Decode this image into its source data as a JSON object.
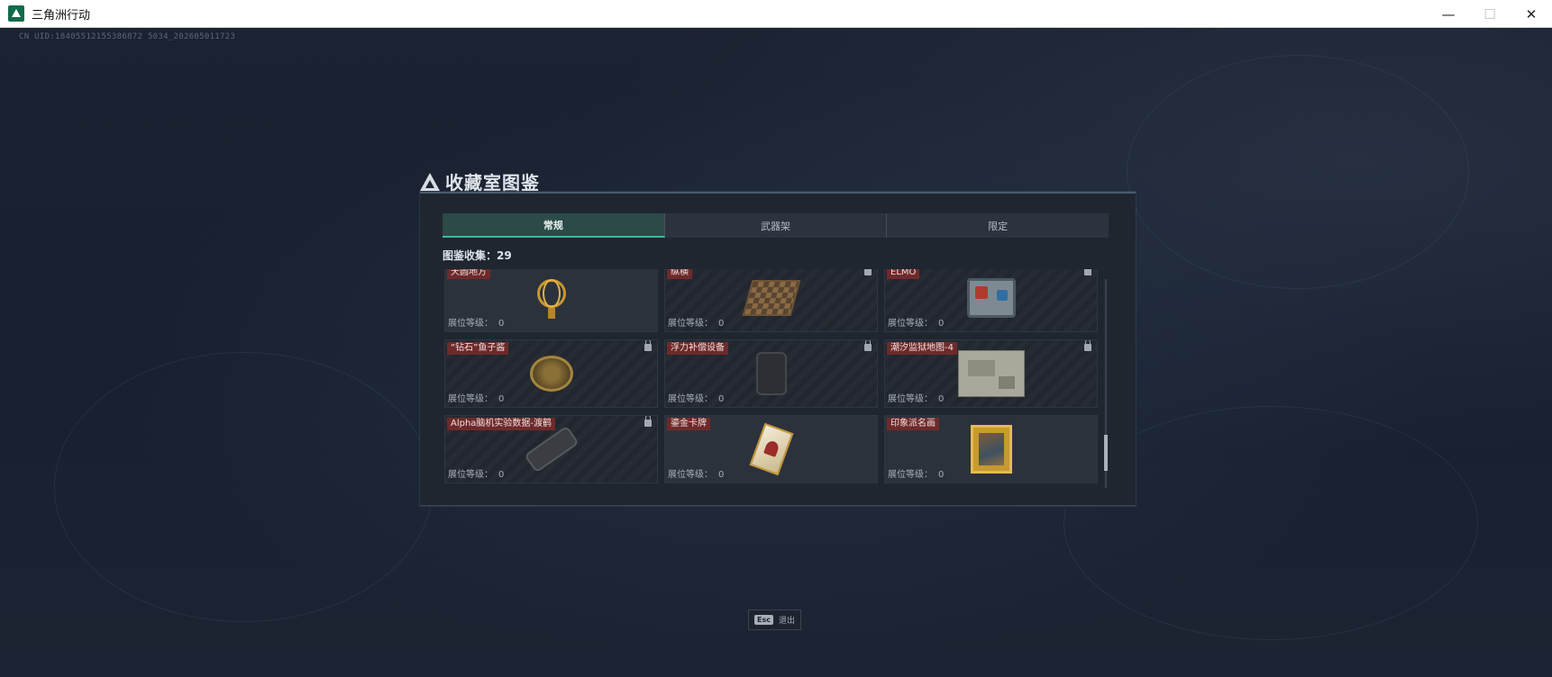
{
  "window": {
    "title": "三角洲行动",
    "controls": {
      "minimize": "—",
      "maximize": "☐",
      "close": "✕"
    }
  },
  "game": {
    "uid_text": "CN UID:18405512155386872 5034_202605011723"
  },
  "collection": {
    "title": "收藏室图鉴",
    "tabs": [
      {
        "label": "常规",
        "active": true
      },
      {
        "label": "武器架",
        "active": false
      },
      {
        "label": "限定",
        "active": false
      }
    ],
    "count_label": "图鉴收集：",
    "count_value": "29",
    "level_label": "展位等级：",
    "items": [
      {
        "name": "天圆地方",
        "level": "0",
        "locked": false,
        "art": "armillary"
      },
      {
        "name": "纵横",
        "level": "0",
        "locked": true,
        "art": "chess"
      },
      {
        "name": "ELMO",
        "level": "0",
        "locked": true,
        "art": "elmo"
      },
      {
        "name": "“钻石”鱼子酱",
        "level": "0",
        "locked": true,
        "art": "tin"
      },
      {
        "name": "浮力补偿设备",
        "level": "0",
        "locked": true,
        "art": "gear"
      },
      {
        "name": "潮汐监狱地图-4",
        "level": "0",
        "locked": true,
        "art": "map"
      },
      {
        "name": "Alpha脑机实验数据-渡鹤",
        "level": "0",
        "locked": true,
        "art": "scope"
      },
      {
        "name": "鎏金卡牌",
        "level": "0",
        "locked": false,
        "art": "card"
      },
      {
        "name": "印象派名画",
        "level": "0",
        "locked": false,
        "art": "frame"
      }
    ]
  },
  "footer": {
    "esc_key": "Esc",
    "esc_label": "退出"
  }
}
